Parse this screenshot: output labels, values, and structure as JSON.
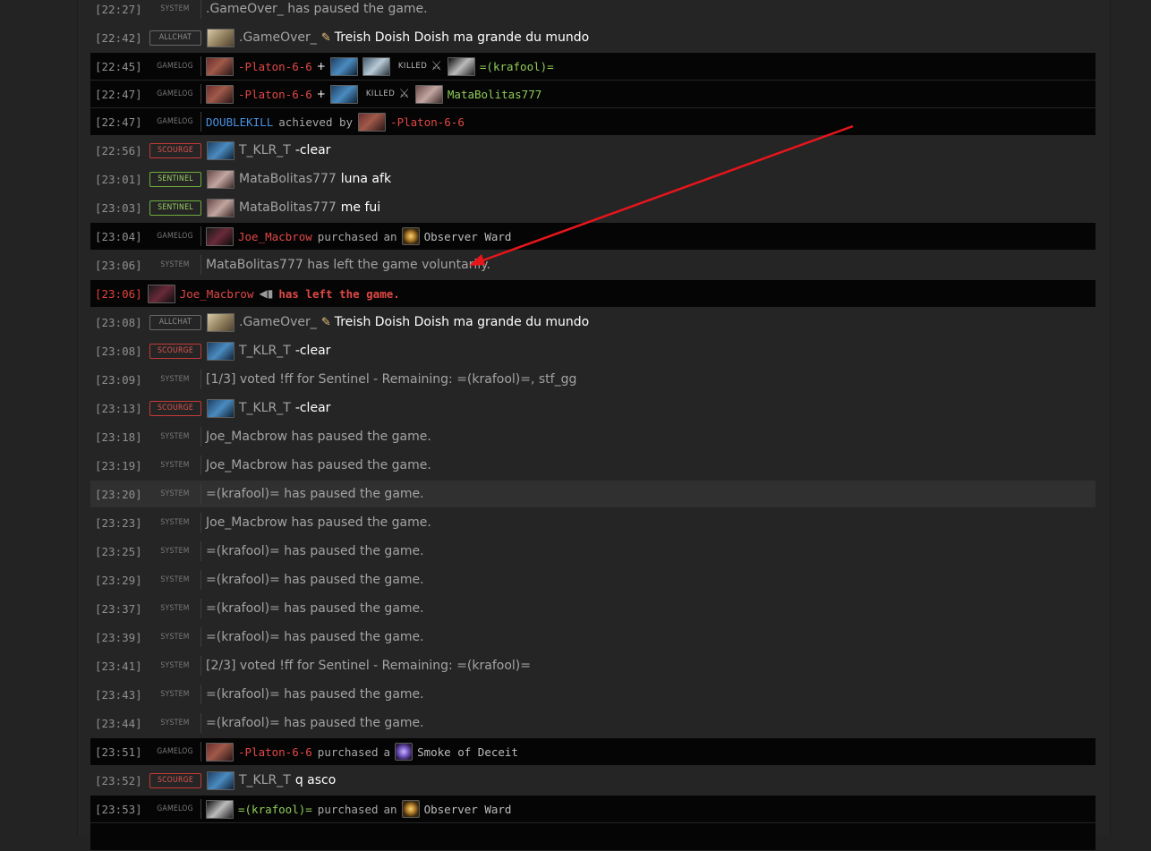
{
  "labels": {
    "system": "SYSTEM",
    "gamelog": "GAMELOG",
    "allchat": "ALLCHAT",
    "scourge": "SCOURGE",
    "sentinel": "SENTINEL",
    "killed": "KILLED"
  },
  "players": {
    "gameover": ".GameOver_",
    "platon": "-Platon-6-6",
    "krafool": "=(krafool)=",
    "matabolitas": "MataBolitas777",
    "klr": "T_KLR_T",
    "joe": "Joe_Macbrow"
  },
  "items": {
    "ward": "Observer Ward",
    "smoke": "Smoke of Deceit"
  },
  "words": {
    "purchased": "purchased",
    "an": "an",
    "a": "a",
    "achieved_by": "achieved by",
    "doublekill": "DOUBLEKILL",
    "has_left": "has left the game."
  },
  "rows": {
    "r0": {
      "time": "[22:27]",
      "text": ".GameOver_ has paused the game."
    },
    "r1": {
      "time": "[22:42]",
      "msg": "Treish Doish Doish ma grande du mundo"
    },
    "r2": {
      "time": "[22:45]"
    },
    "r3": {
      "time": "[22:47]"
    },
    "r4": {
      "time": "[22:47]"
    },
    "r5": {
      "time": "[22:56]",
      "msg": "-clear"
    },
    "r6": {
      "time": "[23:01]",
      "msg": "luna afk"
    },
    "r7": {
      "time": "[23:03]",
      "msg": "me fui"
    },
    "r8": {
      "time": "[23:04]"
    },
    "r9": {
      "time": "[23:06]",
      "text": "MataBolitas777 has left the game voluntarily."
    },
    "r10": {
      "time": "[23:06]"
    },
    "r11": {
      "time": "[23:08]",
      "msg": "Treish Doish Doish ma grande du mundo"
    },
    "r12": {
      "time": "[23:08]",
      "msg": "-clear"
    },
    "r13": {
      "time": "[23:09]",
      "text": "[1/3] voted !ff for Sentinel - Remaining: =(krafool)=, stf_gg"
    },
    "r14": {
      "time": "[23:13]",
      "msg": "-clear"
    },
    "r15": {
      "time": "[23:18]",
      "text": "Joe_Macbrow has paused the game."
    },
    "r16": {
      "time": "[23:19]",
      "text": "Joe_Macbrow has paused the game."
    },
    "r17": {
      "time": "[23:20]",
      "text": "=(krafool)= has paused the game."
    },
    "r18": {
      "time": "[23:23]",
      "text": "Joe_Macbrow has paused the game."
    },
    "r19": {
      "time": "[23:25]",
      "text": "=(krafool)= has paused the game."
    },
    "r20": {
      "time": "[23:29]",
      "text": "=(krafool)= has paused the game."
    },
    "r21": {
      "time": "[23:37]",
      "text": "=(krafool)= has paused the game."
    },
    "r22": {
      "time": "[23:39]",
      "text": "=(krafool)= has paused the game."
    },
    "r23": {
      "time": "[23:41]",
      "text": "[2/3] voted !ff for Sentinel - Remaining: =(krafool)="
    },
    "r24": {
      "time": "[23:43]",
      "text": "=(krafool)= has paused the game."
    },
    "r25": {
      "time": "[23:44]",
      "text": "=(krafool)= has paused the game."
    },
    "r26": {
      "time": "[23:51]"
    },
    "r27": {
      "time": "[23:52]",
      "msg": "q asco"
    },
    "r28": {
      "time": "[23:53]"
    }
  },
  "colors": {
    "background": "#232323",
    "gamelog_row": "#050505",
    "scourge": "#e05450",
    "sentinel": "#8fcc59",
    "doublekill": "#4a90e2",
    "annotation_arrow": "#e8151b"
  }
}
